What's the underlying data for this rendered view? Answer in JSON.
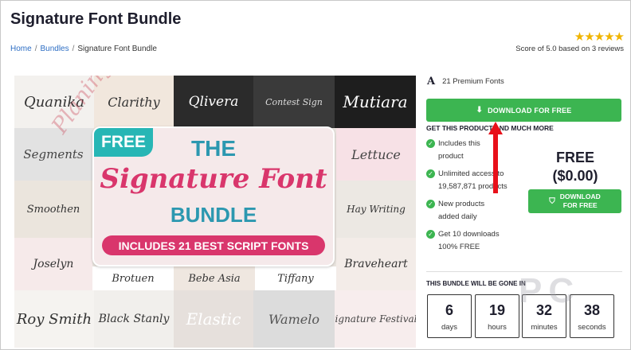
{
  "title": "Signature Font Bundle",
  "breadcrumb": [
    "Home",
    "Bundles",
    "Signature Font Bundle"
  ],
  "rating": {
    "stars": 5,
    "score_text": "Score of 5.0 based on 3 reviews"
  },
  "gallery": {
    "tiles": [
      "Quanika",
      "Clarithy",
      "Qlivera",
      "Contest Sign",
      "Mutiara",
      "Segments",
      "Lettuce",
      "Smoothen",
      "Hay Writing",
      "Joselyn",
      "Brotuen",
      "Bebe Asia",
      "Tiffany",
      "Braveheart",
      "Roy Smith",
      "Black Stanly",
      "Elastic",
      "Wamelo",
      "Signature Festivals"
    ],
    "promo": {
      "free_tag": "FREE",
      "line1": "THE",
      "line2": "Signature Font",
      "line3": "BUNDLE",
      "banner": "INCLUDES 21 BEST SCRIPT FONTS"
    },
    "watermark": "Planing PC"
  },
  "sidebar": {
    "meta_icon": "A",
    "meta": "21 Premium Fonts",
    "download_button": "DOWNLOAD FOR FREE",
    "get_more": "GET THIS PRODUCT AND MUCH MORE",
    "perks": [
      {
        "line1": "Includes this",
        "line2": "product"
      },
      {
        "line1": "Unlimited access to",
        "line2": "19,587,871 products"
      },
      {
        "line1": "New products",
        "line2": "added daily"
      },
      {
        "line1": "Get 10 downloads",
        "line2": "100% FREE"
      }
    ],
    "price_label": "FREE",
    "price_value": "($0.00)",
    "side_button_line1": "DOWNLOAD",
    "side_button_line2": "FOR FREE",
    "gone_heading": "THIS BUNDLE WILL BE GONE IN",
    "countdown": [
      {
        "value": "6",
        "unit": "days"
      },
      {
        "value": "19",
        "unit": "hours"
      },
      {
        "value": "32",
        "unit": "minutes"
      },
      {
        "value": "38",
        "unit": "seconds"
      }
    ]
  },
  "colors": {
    "accent_green": "#3cb551",
    "brand_pink": "#d9366c",
    "brand_teal": "#2c98b0",
    "annotation_red": "#e8101a",
    "star": "#f0b400"
  },
  "icons": [
    "star-icon",
    "download-icon",
    "check-icon",
    "shield-icon",
    "arrow-annotation"
  ]
}
